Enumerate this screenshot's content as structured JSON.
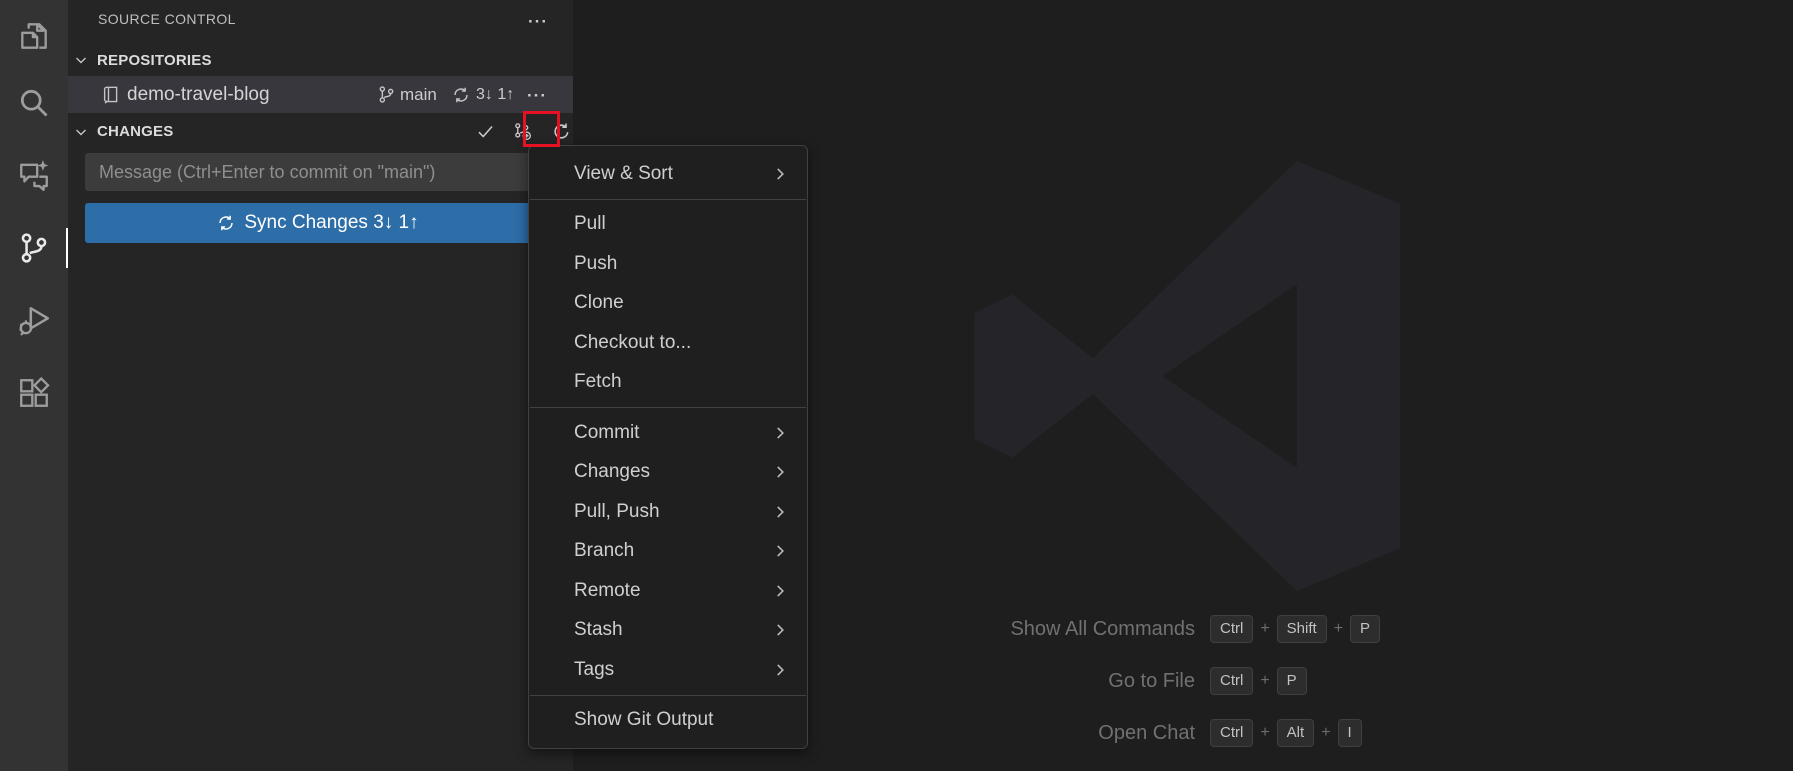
{
  "colors": {
    "activity_bar_bg": "#333333",
    "sidebar_bg": "#252526",
    "editor_bg": "#1e1e1e",
    "menu_bg": "#1f1f1f",
    "button_blue": "#2d6da8",
    "row_highlight": "#37373d",
    "annotation_red": "#e81123"
  },
  "activity_bar": {
    "items": [
      {
        "id": "explorer",
        "icon": "files-icon"
      },
      {
        "id": "search",
        "icon": "search-icon"
      },
      {
        "id": "chat",
        "icon": "chat-sparkle-icon"
      },
      {
        "id": "source-control",
        "icon": "git-branch-icon",
        "active": true
      },
      {
        "id": "run-debug",
        "icon": "debug-icon"
      },
      {
        "id": "extensions",
        "icon": "extensions-icon"
      }
    ]
  },
  "sidebar": {
    "title": "SOURCE CONTROL",
    "repositories_section": {
      "label": "REPOSITORIES"
    },
    "repository": {
      "name": "demo-travel-blog",
      "branch": "main",
      "sync_counts": "3↓ 1↑"
    },
    "changes_section": {
      "label": "CHANGES"
    },
    "commit_input": {
      "placeholder": "Message (Ctrl+Enter to commit on \"main\")",
      "value": ""
    },
    "sync_button": {
      "label": "Sync Changes 3↓ 1↑"
    }
  },
  "context_menu": {
    "items": [
      {
        "label": "View & Sort",
        "submenu": true
      },
      {
        "label": "Pull"
      },
      {
        "label": "Push"
      },
      {
        "label": "Clone"
      },
      {
        "label": "Checkout to..."
      },
      {
        "label": "Fetch"
      },
      {
        "label": "Commit",
        "submenu": true
      },
      {
        "label": "Changes",
        "submenu": true
      },
      {
        "label": "Pull, Push",
        "submenu": true
      },
      {
        "label": "Branch",
        "submenu": true
      },
      {
        "label": "Remote",
        "submenu": true
      },
      {
        "label": "Stash",
        "submenu": true
      },
      {
        "label": "Tags",
        "submenu": true
      },
      {
        "label": "Show Git Output"
      }
    ]
  },
  "editor": {
    "plus": "+",
    "watermark_rows": [
      {
        "label": "Show All Commands",
        "keys": [
          "Ctrl",
          "Shift",
          "P"
        ]
      },
      {
        "label": "Go to File",
        "keys": [
          "Ctrl",
          "P"
        ]
      },
      {
        "label": "Open Chat",
        "keys": [
          "Ctrl",
          "Alt",
          "I"
        ]
      }
    ]
  }
}
